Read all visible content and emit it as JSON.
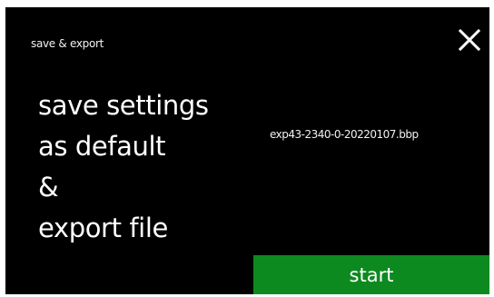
{
  "header": {
    "title": "save & export",
    "close_icon": "close-icon"
  },
  "main": {
    "lines": [
      "save settings",
      "as default",
      "&",
      "export file"
    ],
    "filename": "exp43-2340-0-20220107.bbp"
  },
  "footer": {
    "start_label": "start"
  },
  "colors": {
    "background": "#000000",
    "text": "#ffffff",
    "start_button": "#0d8a1f"
  }
}
